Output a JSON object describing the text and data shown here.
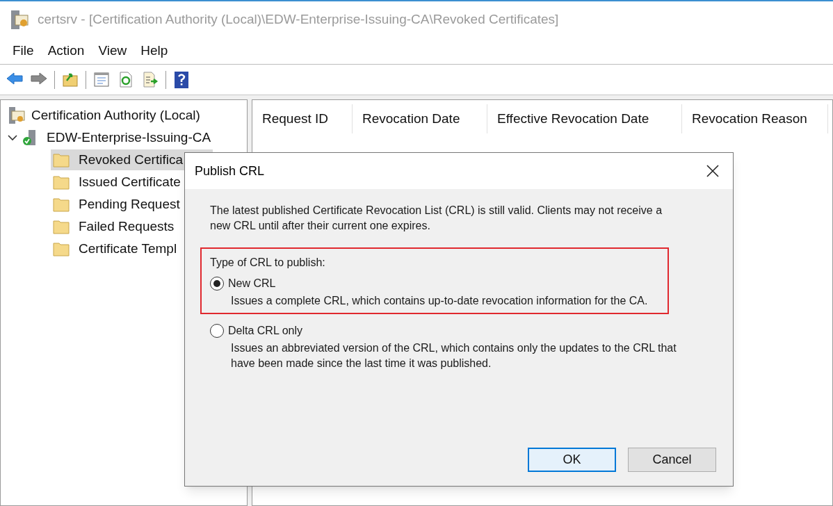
{
  "window": {
    "title": "certsrv - [Certification Authority (Local)\\EDW-Enterprise-Issuing-CA\\Revoked Certificates]"
  },
  "menu": [
    "File",
    "Action",
    "View",
    "Help"
  ],
  "toolbar": [
    {
      "kind": "back"
    },
    {
      "kind": "forward"
    },
    {
      "kind": "sep"
    },
    {
      "kind": "up"
    },
    {
      "kind": "sep"
    },
    {
      "kind": "properties"
    },
    {
      "kind": "refresh"
    },
    {
      "kind": "export"
    },
    {
      "kind": "sep"
    },
    {
      "kind": "help"
    }
  ],
  "tree": {
    "label": "Certification Authority (Local)",
    "children": [
      {
        "label": "EDW-Enterprise-Issuing-CA",
        "expanded": true,
        "children": [
          {
            "label": "Revoked Certifica",
            "selected": true
          },
          {
            "label": "Issued Certificate",
            "selected": false
          },
          {
            "label": "Pending Request",
            "selected": false
          },
          {
            "label": "Failed Requests",
            "selected": false
          },
          {
            "label": "Certificate Templ",
            "selected": false
          }
        ]
      }
    ]
  },
  "table": {
    "columns": [
      "Request ID",
      "Revocation Date",
      "Effective Revocation Date",
      "Revocation Reason"
    ]
  },
  "dialog": {
    "title": "Publish CRL",
    "message": "The latest published Certificate Revocation List (CRL) is still valid. Clients may not receive a new CRL until after their current one expires.",
    "group_label": "Type of CRL to publish:",
    "options": [
      {
        "label": "New CRL",
        "description": "Issues a complete CRL, which contains up-to-date revocation information for the CA.",
        "selected": true,
        "highlighted": true
      },
      {
        "label": "Delta CRL only",
        "description": "Issues an abbreviated version of the CRL, which contains only the updates to the CRL that have been made since the last time it was published.",
        "selected": false,
        "highlighted": false
      }
    ],
    "buttons": [
      {
        "label": "OK",
        "default": true
      },
      {
        "label": "Cancel",
        "default": false
      }
    ]
  }
}
